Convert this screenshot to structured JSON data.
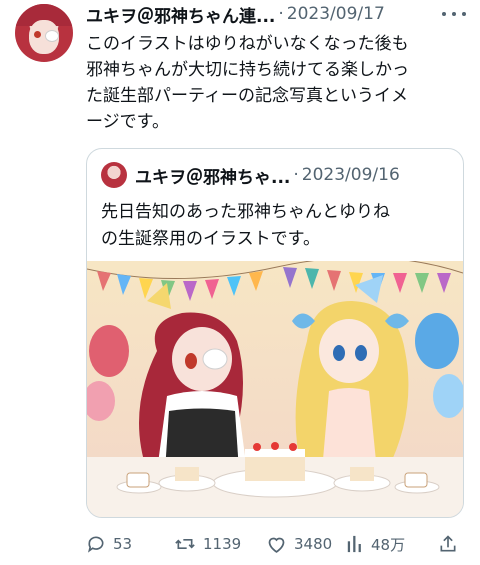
{
  "tweet": {
    "author_name": "ユキヲ＠邪神ちゃん連...",
    "separator": "·",
    "date": "2023/09/17",
    "text": "このイラストはゆりねがいなくなった後も\n邪神ちゃんが大切に持ち続けてる楽しかっ\nた誕生部パーティーの記念写真というイメ\nージです。"
  },
  "quote": {
    "author_name": "ユキヲ＠邪神ちゃ...",
    "separator": "·",
    "date": "2023/09/16",
    "text": "先日告知のあった邪神ちゃんとゆりね\nの生誕祭用のイラストです。",
    "image_alt": "anime-illustration-birthday-party"
  },
  "actions": {
    "replies": "53",
    "retweets": "1139",
    "likes": "3480",
    "views": "48万"
  },
  "icons": {
    "more": "more-icon",
    "reply": "reply-icon",
    "retweet": "retweet-icon",
    "like": "like-icon",
    "views": "views-icon",
    "share": "share-icon"
  },
  "colors": {
    "text": "#0f1419",
    "secondary": "#536471",
    "border": "#cfd9de"
  }
}
